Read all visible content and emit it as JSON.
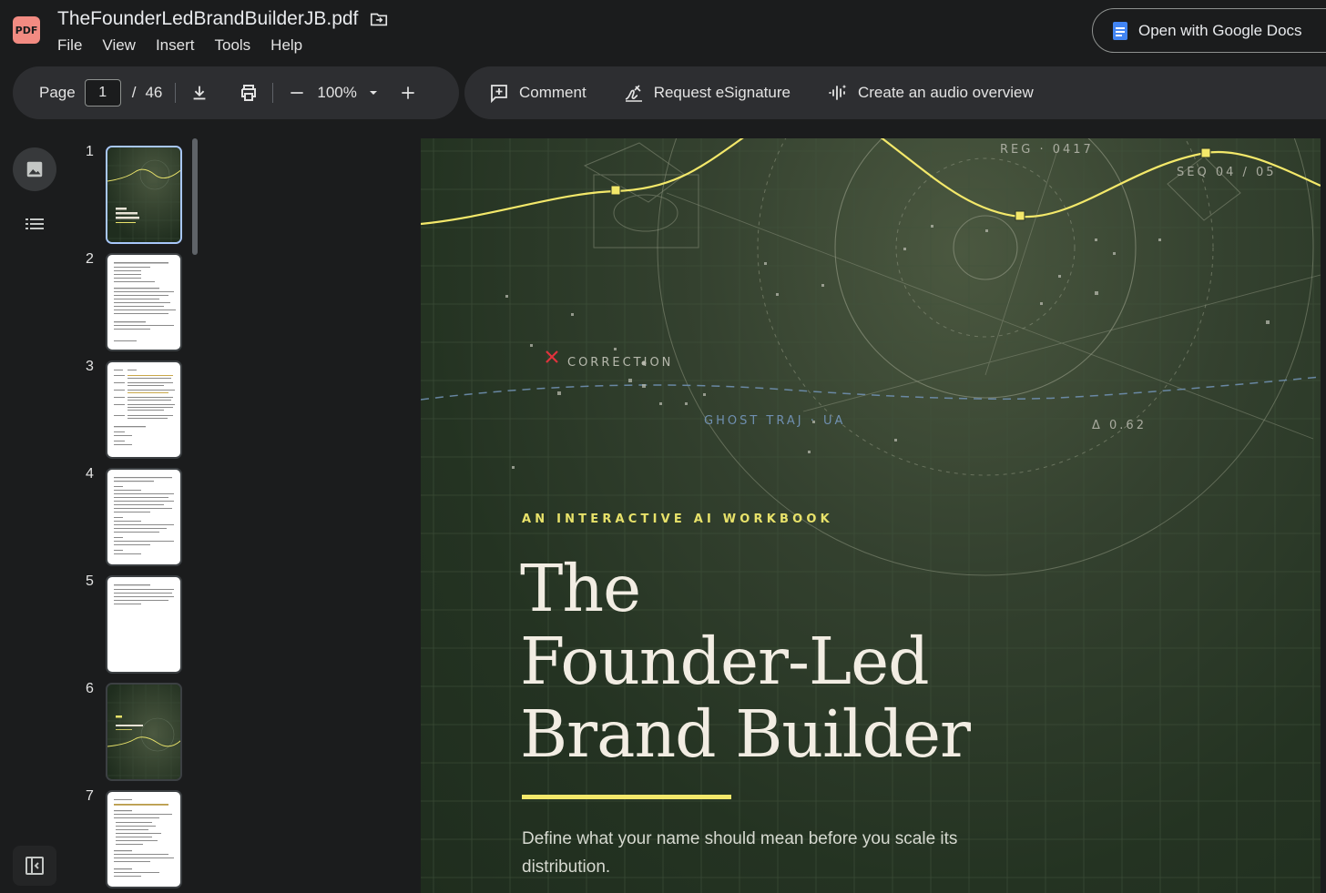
{
  "app": {
    "file_badge": "PDF",
    "document_title": "TheFounderLedBrandBuilderJB.pdf",
    "menu": [
      "File",
      "View",
      "Insert",
      "Tools",
      "Help"
    ],
    "open_with_label": "Open with Google Docs"
  },
  "toolbar": {
    "page_label": "Page",
    "current_page": "1",
    "page_separator": "/",
    "total_pages": "46",
    "zoom": "100%",
    "comment_label": "Comment",
    "esign_label": "Request eSignature",
    "audio_label": "Create an audio overview"
  },
  "thumbnails": [
    {
      "number": "1",
      "style": "cover",
      "selected": true
    },
    {
      "number": "2",
      "style": "text"
    },
    {
      "number": "3",
      "style": "table"
    },
    {
      "number": "4",
      "style": "text"
    },
    {
      "number": "5",
      "style": "text-short"
    },
    {
      "number": "6",
      "style": "divider"
    },
    {
      "number": "7",
      "style": "text"
    }
  ],
  "page": {
    "hud_reg": "REG · 0417",
    "hud_seq": "SEQ 04 / 05",
    "hud_correction": "CORRECTION",
    "hud_ghost": "GHOST TRAJ · UA",
    "hud_delta": "Δ 0.62",
    "eyebrow": "AN INTERACTIVE AI WORKBOOK",
    "title_line1": "The",
    "title_line2": "Founder-Led",
    "title_line3": "Brand Builder",
    "subtitle": "Define what your name should mean before you scale its distribution."
  },
  "colors": {
    "accent_yellow": "#f3e86a",
    "hud_blue": "#6f8fb0",
    "correction_red": "#e0323c",
    "selected_thumb": "#a8c7fa"
  }
}
